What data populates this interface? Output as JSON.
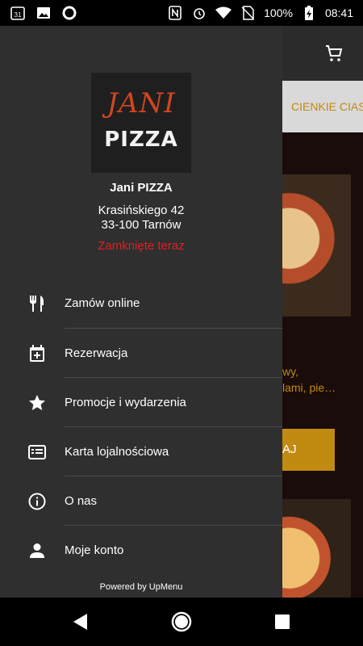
{
  "status_bar": {
    "battery_text": "100%",
    "time": "08:41",
    "calendar_day": "31"
  },
  "background_app": {
    "tab_label": "CIENKIE CIAS",
    "desc_line1": "wy,",
    "desc_line2": "lami, pie…",
    "button_label": "AJ"
  },
  "drawer": {
    "logo": {
      "line1": "JANI",
      "line2": "PIZZA"
    },
    "restaurant_name": "Jani PIZZA",
    "address_line1": "Krasińskiego 42",
    "address_line2": "33-100 Tarnów",
    "status_text": "Zamknięte teraz",
    "items": [
      {
        "label": "Zamów online",
        "icon": "cutlery-icon"
      },
      {
        "label": "Rezerwacja",
        "icon": "calendar-add-icon"
      },
      {
        "label": "Promocje i wydarzenia",
        "icon": "star-icon"
      },
      {
        "label": "Karta lojalnościowa",
        "icon": "loyalty-card-icon"
      },
      {
        "label": "O nas",
        "icon": "info-icon"
      },
      {
        "label": "Moje konto",
        "icon": "person-icon"
      }
    ],
    "powered_by": "Powered by UpMenu"
  },
  "colors": {
    "drawer_bg": "#2f2f2f",
    "accent": "#c18a10",
    "closed_status": "#e02020",
    "logo_red": "#d1451f"
  }
}
